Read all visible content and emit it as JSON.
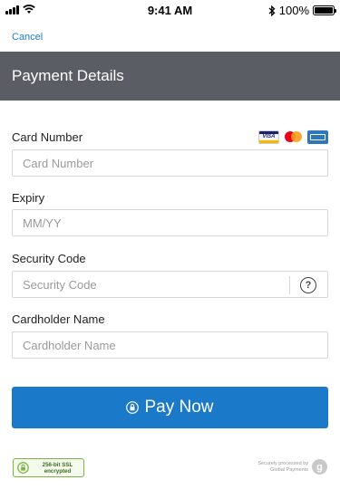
{
  "status_bar": {
    "time": "9:41 AM",
    "battery": "100%",
    "icons": [
      "signal-icon",
      "wifi-icon",
      "bluetooth-icon",
      "battery-icon"
    ]
  },
  "nav": {
    "cancel_label": "Cancel"
  },
  "header": {
    "title": "Payment Details"
  },
  "form": {
    "card_number": {
      "label": "Card Number",
      "placeholder": "Card Number",
      "value": "",
      "card_logos": [
        "visa-logo",
        "mastercard-logo",
        "amex-logo"
      ],
      "visa_text": "VISA"
    },
    "expiry": {
      "label": "Expiry",
      "placeholder": "MM/YY",
      "value": ""
    },
    "security_code": {
      "label": "Security Code",
      "placeholder": "Security Code",
      "value": "",
      "help_glyph": "?"
    },
    "cardholder_name": {
      "label": "Cardholder Name",
      "placeholder": "Cardholder Name",
      "value": ""
    }
  },
  "pay_button": {
    "label": "Pay Now"
  },
  "footer": {
    "ssl_line1": "256-bit SSL",
    "ssl_line2": "encrypted",
    "secure_line1": "Securely processed by",
    "secure_line2": "Global Payments",
    "gp_logo_letter": "g"
  },
  "colors": {
    "header_bg": "#5b5d65",
    "accent": "#1a79c8",
    "link": "#1f7ad6",
    "ssl_green": "#7cb342"
  }
}
